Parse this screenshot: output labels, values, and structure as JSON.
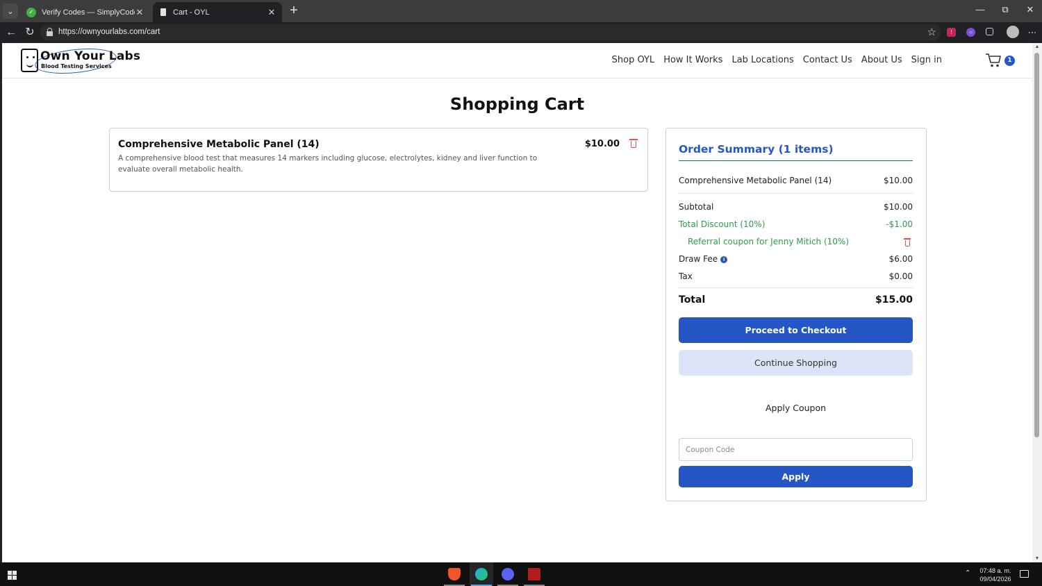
{
  "browser": {
    "tabs": [
      {
        "title": "Verify Codes — SimplyCodes",
        "active": false
      },
      {
        "title": "Cart - OYL",
        "active": true
      }
    ],
    "url": "https://ownyourlabs.com/cart"
  },
  "site": {
    "logo_name": "Own Your Labs",
    "logo_sub": "Blood Testing Services",
    "nav": [
      "Shop OYL",
      "How It Works",
      "Lab Locations",
      "Contact Us",
      "About Us",
      "Sign in"
    ],
    "cart_count": "1"
  },
  "page_title": "Shopping Cart",
  "cart_item": {
    "name": "Comprehensive Metabolic Panel (14)",
    "description": "A comprehensive blood test that measures 14 markers including glucose, electrolytes, kidney and liver function to evaluate overall metabolic health.",
    "price": "$10.00"
  },
  "summary": {
    "heading": "Order Summary (1 items)",
    "line_item_name": "Comprehensive Metabolic Panel (14)",
    "line_item_price": "$10.00",
    "subtotal_label": "Subtotal",
    "subtotal_value": "$10.00",
    "discount_label": "Total Discount (10%)",
    "discount_value": "-$1.00",
    "coupon_label": "Referral coupon for Jenny Mitich (10%)",
    "draw_fee_label": "Draw Fee",
    "draw_fee_value": "$6.00",
    "tax_label": "Tax",
    "tax_value": "$0.00",
    "total_label": "Total",
    "total_value": "$15.00",
    "checkout_label": "Proceed to Checkout",
    "continue_label": "Continue Shopping",
    "apply_coupon_heading": "Apply Coupon",
    "coupon_placeholder": "Coupon Code",
    "apply_label": "Apply"
  },
  "taskbar": {
    "time": "07:48 a. m.",
    "date": "09/04/2026"
  },
  "colors": {
    "accent": "#2457c5",
    "discount_green": "#2e9b4f",
    "delete_red": "#e05252"
  }
}
